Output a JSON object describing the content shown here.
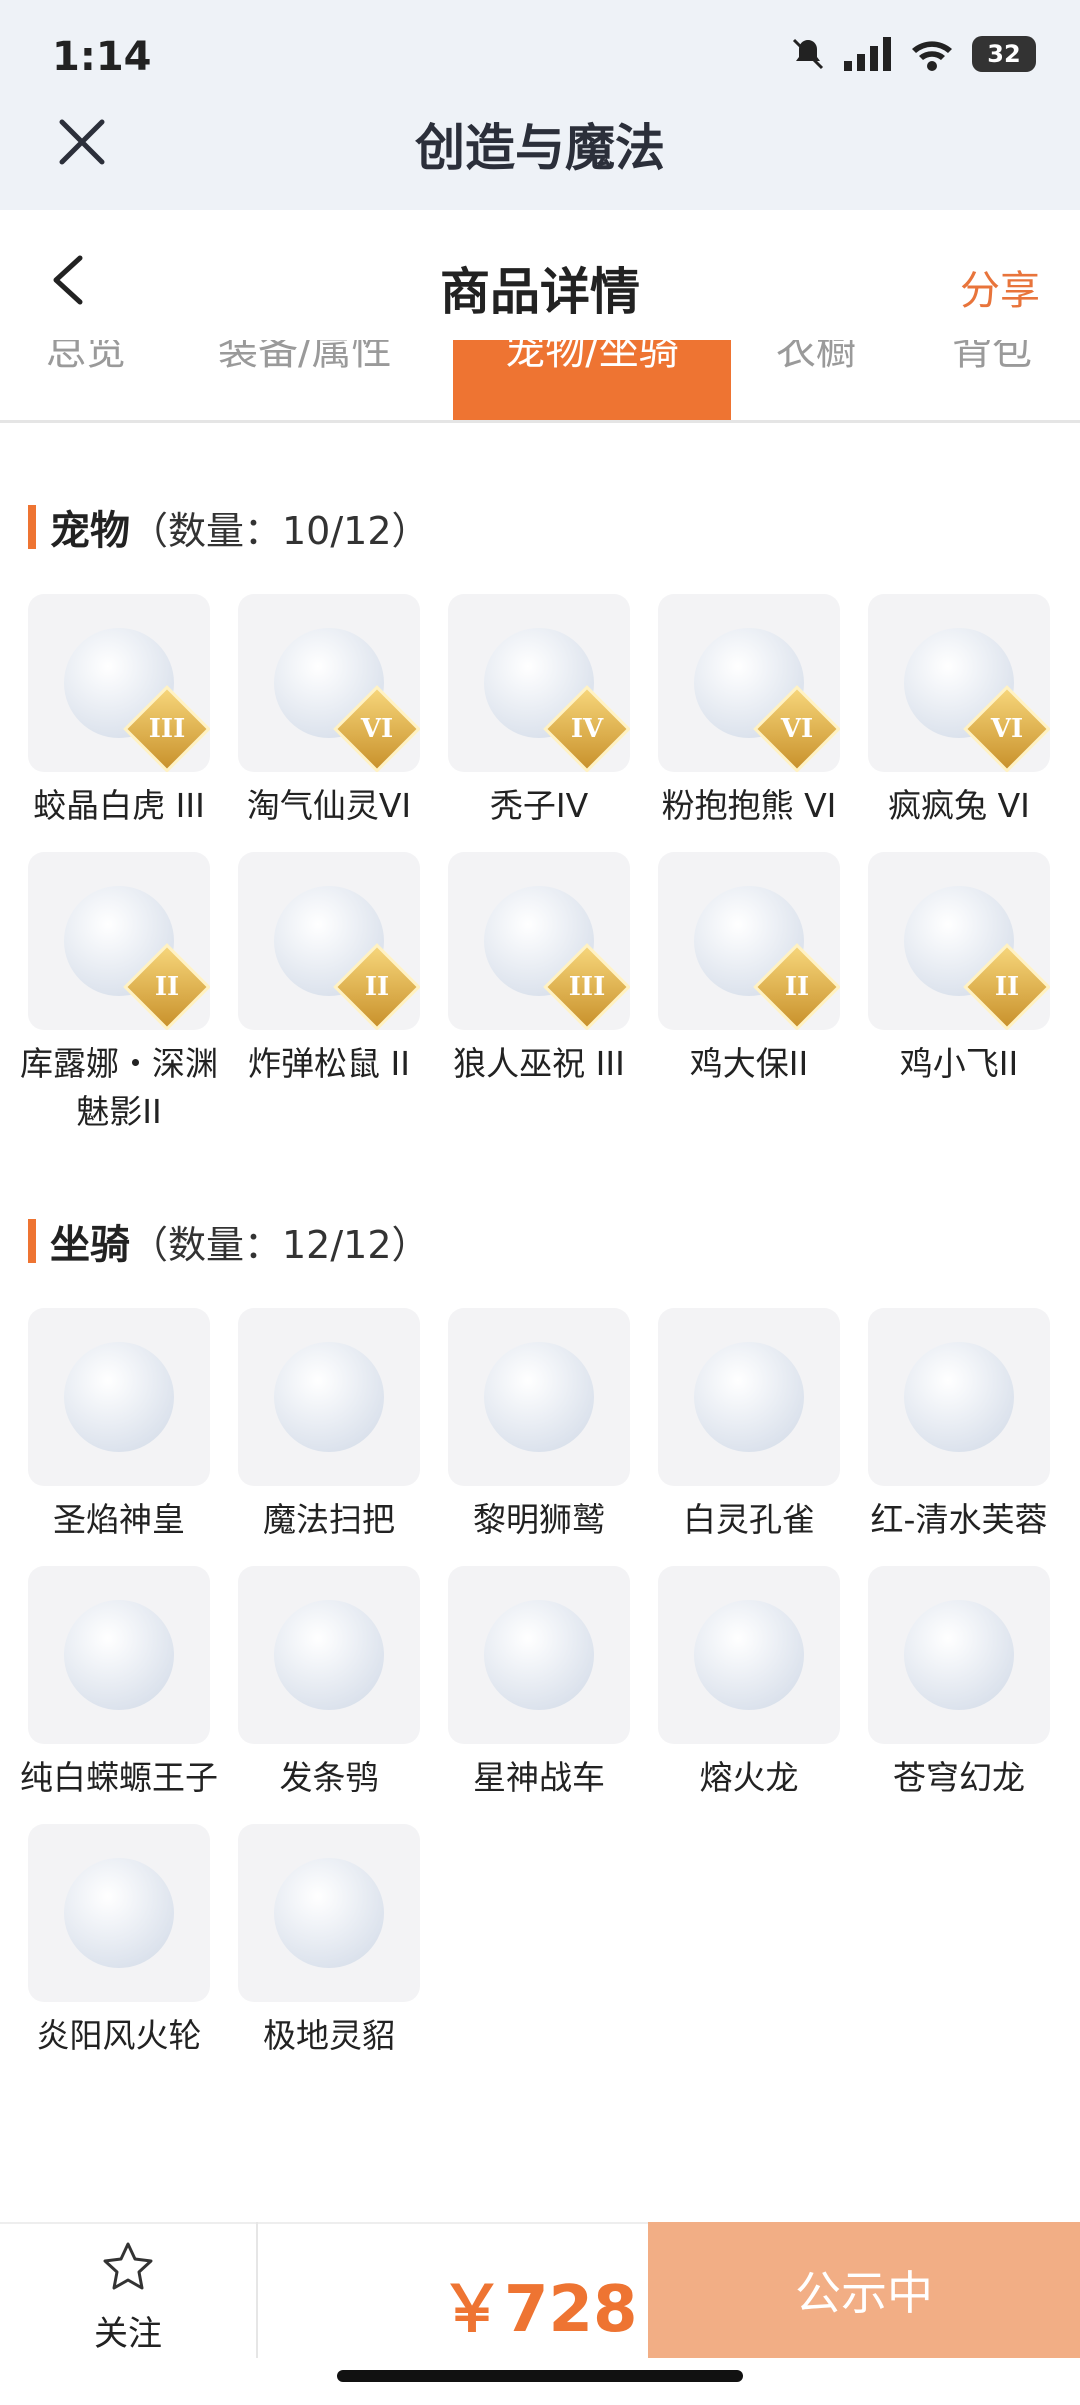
{
  "status": {
    "time": "1:14",
    "battery": "32"
  },
  "app": {
    "title": "创造与魔法"
  },
  "nav": {
    "title": "商品详情",
    "share": "分享"
  },
  "tabs": [
    {
      "label": "总览",
      "active": false
    },
    {
      "label": "装备/属性",
      "active": false
    },
    {
      "label": "宠物/坐骑",
      "active": true
    },
    {
      "label": "衣橱",
      "active": false
    },
    {
      "label": "背包",
      "active": false
    }
  ],
  "pets": {
    "title": "宠物",
    "count": "（数量：10/12）",
    "items": [
      {
        "name": "蛟晶白虎 III",
        "level": "III",
        "icon": "🐯"
      },
      {
        "name": "淘气仙灵VI",
        "level": "VI",
        "icon": "🐶"
      },
      {
        "name": "秃子IV",
        "level": "IV",
        "icon": "😑"
      },
      {
        "name": "粉抱抱熊 VI",
        "level": "VI",
        "icon": "🐻"
      },
      {
        "name": "疯疯兔 VI",
        "level": "VI",
        "icon": "🐰"
      },
      {
        "name": "库露娜・深渊魅影II",
        "level": "II",
        "icon": "🧚"
      },
      {
        "name": "炸弹松鼠 II",
        "level": "II",
        "icon": "🐿️"
      },
      {
        "name": "狼人巫祝 III",
        "level": "III",
        "icon": "🐺"
      },
      {
        "name": "鸡大保II",
        "level": "II",
        "icon": "🐦"
      },
      {
        "name": "鸡小飞II",
        "level": "II",
        "icon": "🐤"
      }
    ]
  },
  "mounts": {
    "title": "坐骑",
    "count": "（数量：12/12）",
    "items": [
      {
        "name": "圣焰神皇",
        "icon": "🐉"
      },
      {
        "name": "魔法扫把",
        "icon": "🧹"
      },
      {
        "name": "黎明狮鹫",
        "icon": "🦅"
      },
      {
        "name": "白灵孔雀",
        "icon": "🦚"
      },
      {
        "name": "红-清水芙蓉",
        "icon": "🪷"
      },
      {
        "name": "纯白蝾螈王子",
        "icon": "🦎"
      },
      {
        "name": "发条鸮",
        "icon": "🦉"
      },
      {
        "name": "星神战车",
        "icon": "🐴"
      },
      {
        "name": "熔火龙",
        "icon": "🐲"
      },
      {
        "name": "苍穹幻龙",
        "icon": "🐉"
      },
      {
        "name": "炎阳风火轮",
        "icon": "⭕"
      },
      {
        "name": "极地灵貂",
        "icon": "🦊"
      }
    ]
  },
  "footer": {
    "follow_label": "关注",
    "price": "￥728",
    "action_label": "公示中"
  },
  "colors": {
    "accent": "#ee7432",
    "action_bg": "#f2ae85"
  }
}
